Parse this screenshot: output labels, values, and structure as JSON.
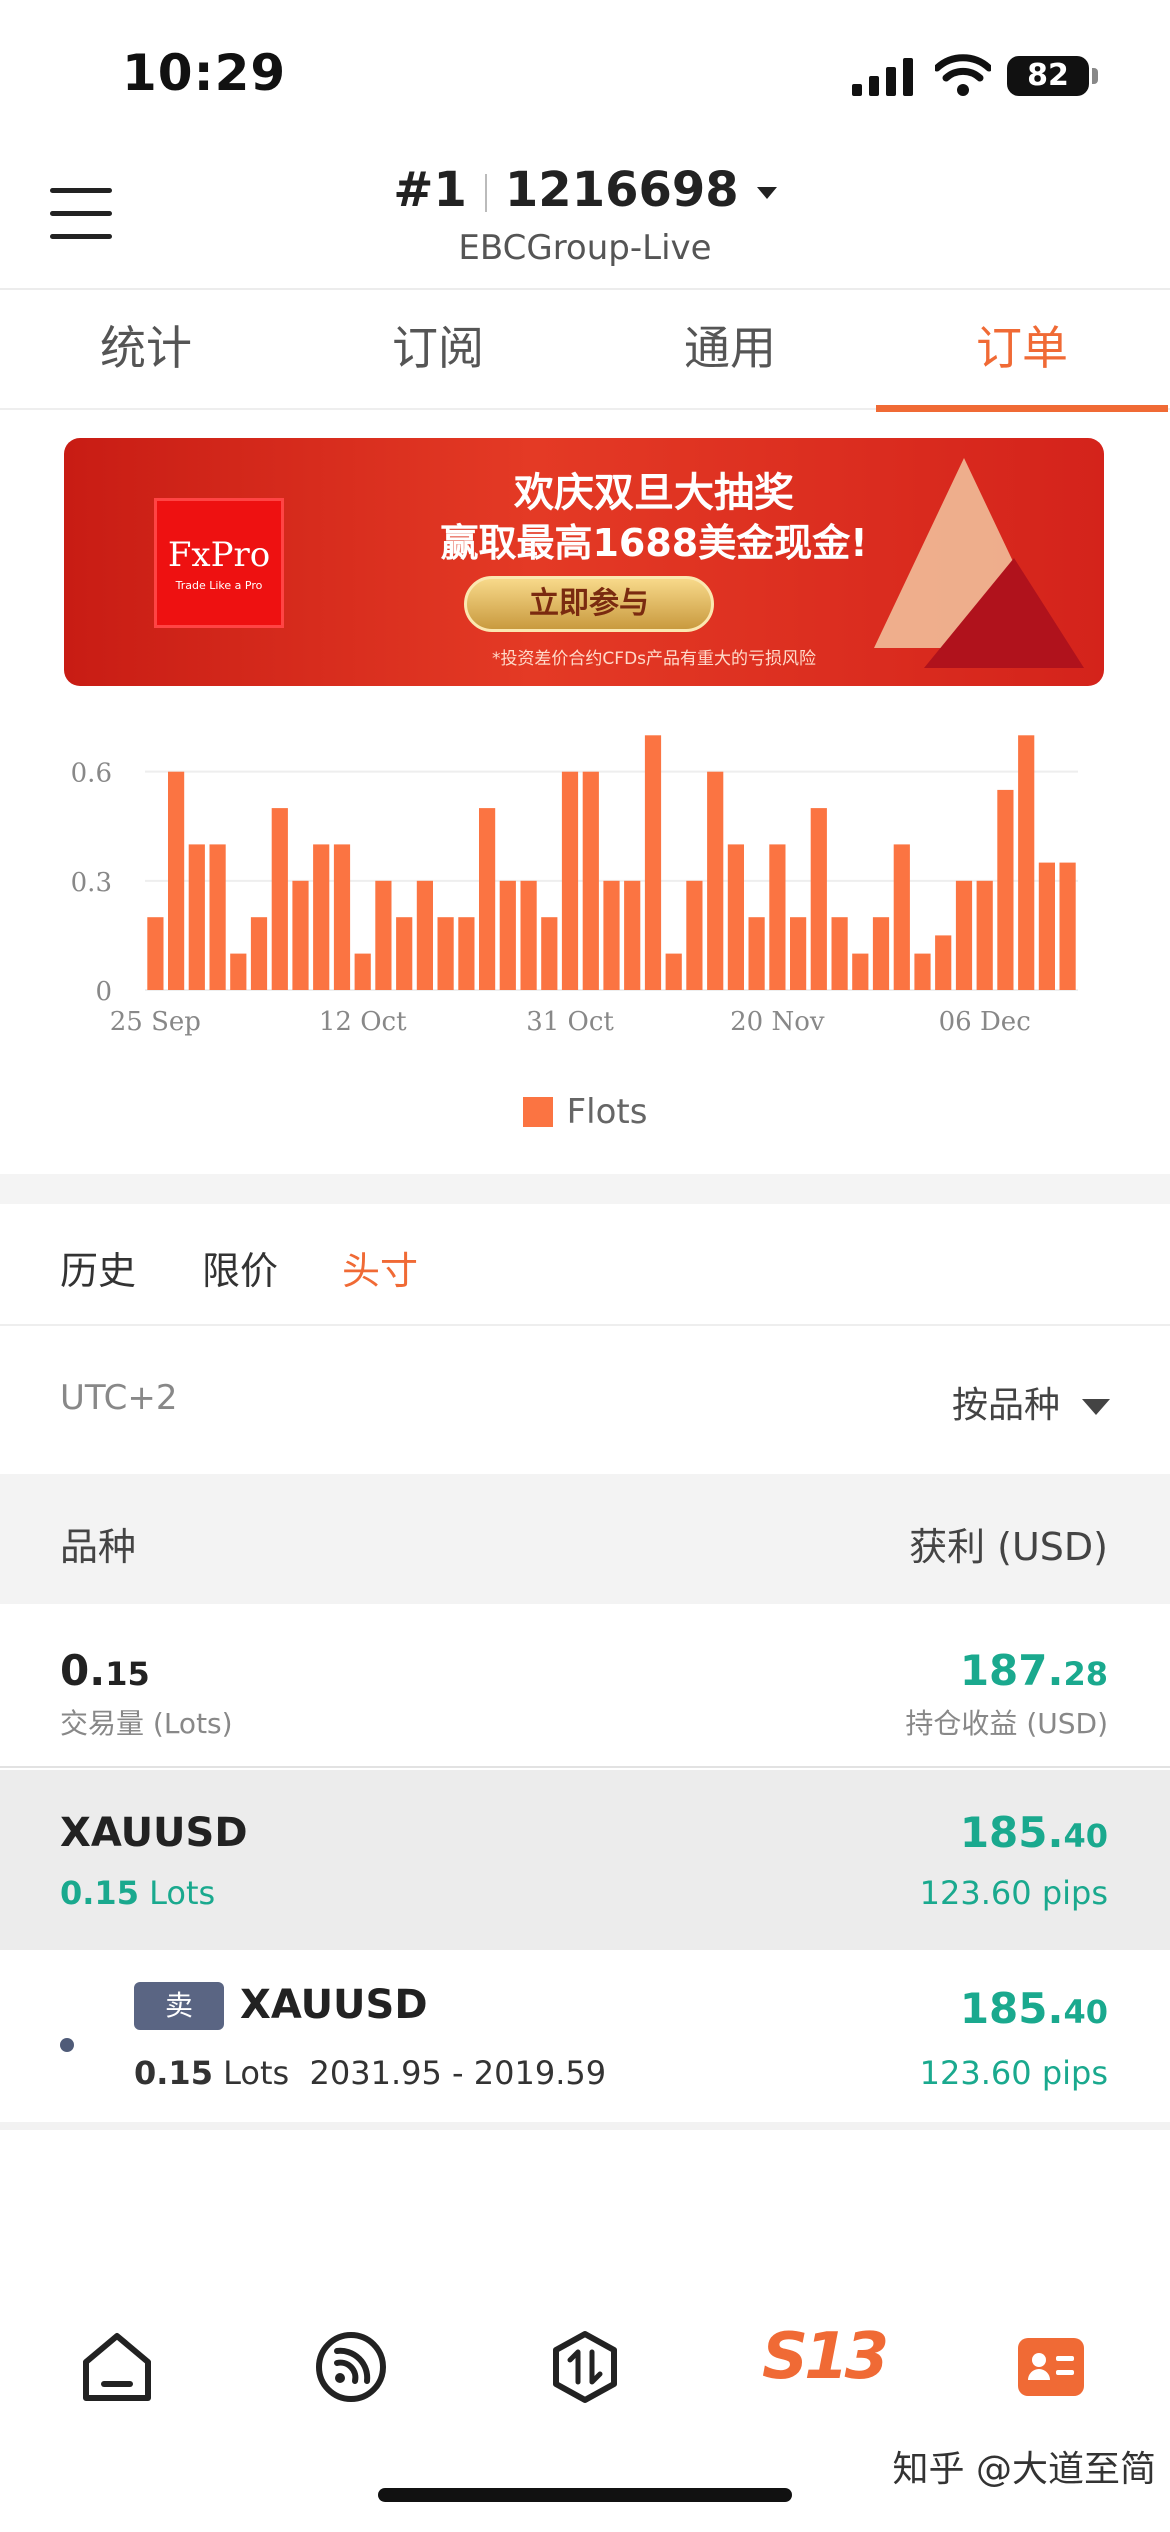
{
  "status": {
    "time": "10:29",
    "battery": "82"
  },
  "header": {
    "account_number": "#1",
    "account_id": "1216698",
    "server": "EBCGroup-Live"
  },
  "tabs": [
    {
      "label": "统计"
    },
    {
      "label": "订阅"
    },
    {
      "label": "通用"
    },
    {
      "label": "订单"
    }
  ],
  "banner": {
    "logo_text": "FxPro",
    "logo_tagline": "Trade Like a Pro",
    "line1": "欢庆双旦大抽奖",
    "line2": "赢取最高1688美金现金!",
    "button": "立即参与",
    "note": "*投资差价合约CFDs产品有重大的亏损风险"
  },
  "chart_data": {
    "type": "bar",
    "series": [
      {
        "name": "Flots",
        "values": [
          0.2,
          0.6,
          0.4,
          0.4,
          0.1,
          0.2,
          0.5,
          0.3,
          0.4,
          0.4,
          0.1,
          0.3,
          0.2,
          0.3,
          0.2,
          0.2,
          0.5,
          0.3,
          0.3,
          0.2,
          0.6,
          0.6,
          0.3,
          0.3,
          0.7,
          0.1,
          0.3,
          0.6,
          0.4,
          0.2,
          0.4,
          0.2,
          0.5,
          0.2,
          0.1,
          0.2,
          0.4,
          0.1,
          0.15,
          0.3,
          0.3,
          0.55,
          0.7,
          0.35,
          0.35
        ]
      }
    ],
    "x_tick_labels": [
      "25 Sep",
      "12 Oct",
      "31 Oct",
      "20 Nov",
      "06 Dec"
    ],
    "x_tick_positions": [
      0,
      10,
      20,
      30,
      40
    ],
    "y_ticks": [
      "0",
      "0.3",
      "0.6"
    ],
    "ylim": [
      0,
      0.72
    ],
    "legend": "bottom-center",
    "bar_color": "#fb7442"
  },
  "subtabs": [
    {
      "label": "历史"
    },
    {
      "label": "限价"
    },
    {
      "label": "头寸"
    }
  ],
  "filter": {
    "timezone": "UTC+2",
    "sort_label": "按品种"
  },
  "columns": {
    "left": "品种",
    "right": "获利 (USD)"
  },
  "summary": {
    "volume_int": "0.",
    "volume_dec": "15",
    "volume_label": "交易量 (Lots)",
    "profit_int": "187.",
    "profit_dec": "28",
    "profit_label": "持仓收益 (USD)"
  },
  "group": {
    "symbol": "XAUUSD",
    "lots_value": "0.15",
    "lots_unit": " Lots",
    "profit_int": "185.",
    "profit_dec": "40",
    "pips": "123.60 pips"
  },
  "order": {
    "side": "卖",
    "symbol": "XAUUSD",
    "lots_value": "0.15",
    "lots_unit": " Lots",
    "prices": "2031.95 - 2019.59",
    "profit_int": "185.",
    "profit_dec": "40",
    "pips": "123.60 pips"
  },
  "bottom_nav": {
    "brand": "S13"
  },
  "watermark": "知乎 @大道至简",
  "colors": {
    "accent": "#f06a35",
    "profit": "#1aa98e",
    "bar": "#fb7442"
  }
}
